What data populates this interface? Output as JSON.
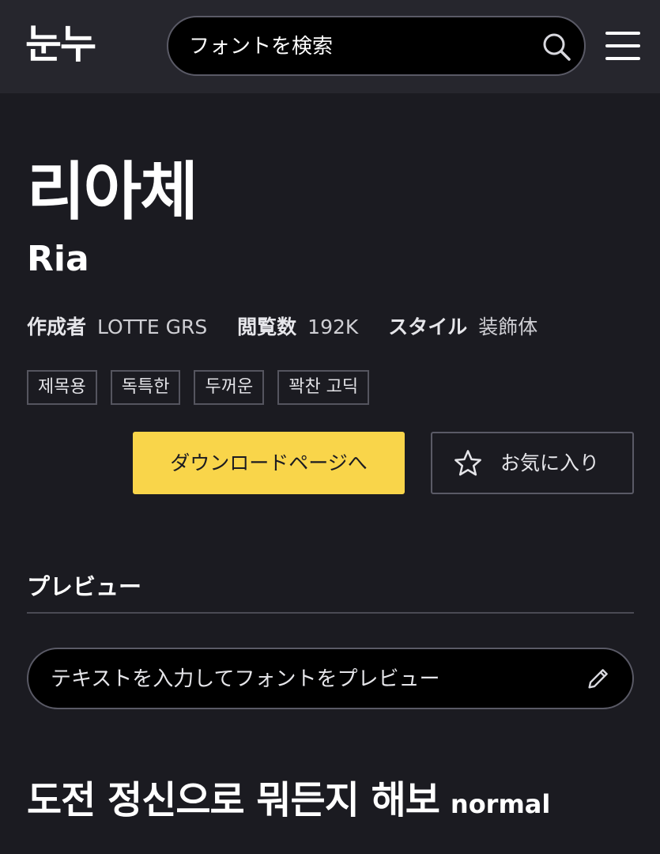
{
  "header": {
    "logo": "눈누",
    "search_placeholder": "フォントを検索"
  },
  "font": {
    "title": "리아체",
    "subtitle": "Ria"
  },
  "meta": [
    {
      "key": "作成者",
      "value": "LOTTE GRS"
    },
    {
      "key": "閲覧数",
      "value": "192K"
    },
    {
      "key": "スタイル",
      "value": "装飾体"
    }
  ],
  "tags": [
    "제목용",
    "독특한",
    "두꺼운",
    "꽉찬 고딕"
  ],
  "actions": {
    "download_label": "ダウンロードページへ",
    "favorite_label": "お気に入り"
  },
  "preview": {
    "section_title": "プレビュー",
    "input_placeholder": "テキストを入力してフォントをプレビュー",
    "sample_text": "도전 정신으로 뭐든지 해보",
    "sample_weight": "normal"
  },
  "colors": {
    "background": "#1b1b21",
    "header_bg": "#26262d",
    "accent": "#f9d54a"
  },
  "icons": {
    "search": "search-icon",
    "menu": "menu-icon",
    "favorite": "star-icon",
    "edit": "pencil-icon"
  }
}
